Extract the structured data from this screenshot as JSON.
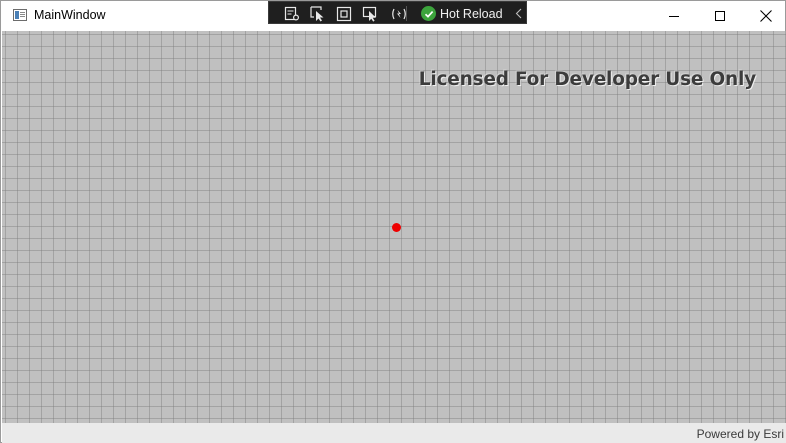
{
  "window": {
    "title": "MainWindow",
    "controls": [
      "minimize-icon",
      "maximize-icon",
      "close-icon"
    ]
  },
  "dev_toolbar": {
    "icons": [
      "live-visual-tree-icon",
      "select-element-icon",
      "display-layout-adorners-icon",
      "track-focused-element-icon",
      "preview-selection-icon"
    ],
    "hot_reload": {
      "label": "Hot Reload",
      "status_color": "#3ca43c"
    }
  },
  "map": {
    "license_watermark": "Licensed For Developer Use Only",
    "location_marker_color": "#ee0000",
    "attribution": "Powered by Esri"
  }
}
